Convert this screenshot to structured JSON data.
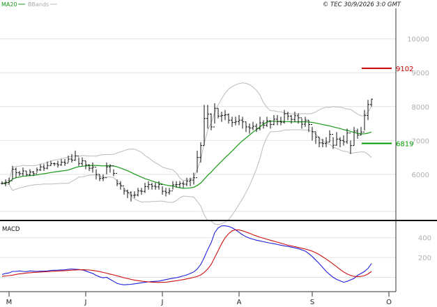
{
  "header": {
    "copyright": "© TEC 30/9/2026 3:0 GMT"
  },
  "legend": [
    {
      "label": "MA20",
      "color": "#1a9a1a"
    },
    {
      "label": "BBands",
      "color": "#bbbbbb"
    }
  ],
  "colors": {
    "price_bars": "#111111",
    "ma20": "#1a9a1a",
    "bbands": "#bbbbbb",
    "resistance": "#cc0000",
    "support": "#009900",
    "macd": "#1f1fdc",
    "signal": "#cc1010",
    "grid": "#e2e2e2"
  },
  "chart_data": [
    {
      "type": "ohlc",
      "panel": "price",
      "y_ticks": [
        6000,
        7000,
        8000,
        9000,
        10000
      ],
      "y_tick_labels": [
        "6000",
        "7000",
        "8000",
        "9000",
        "10000"
      ],
      "ylim": [
        4700,
        10900
      ],
      "x_ticks": [
        {
          "label": "M",
          "index": 2
        },
        {
          "label": "J",
          "index": 24
        },
        {
          "label": "J",
          "index": 46
        },
        {
          "label": "A",
          "index": 68
        },
        {
          "label": "S",
          "index": 89
        },
        {
          "label": "O",
          "index": 111
        }
      ],
      "levels": [
        {
          "name": "resistance",
          "label": "9102",
          "value": 9130,
          "color": "#cc0000"
        },
        {
          "name": "support",
          "label": "6819",
          "value": 6915,
          "color": "#009900"
        }
      ],
      "close": [
        5730,
        5760,
        5810,
        6150,
        6050,
        6020,
        6100,
        5990,
        6070,
        6020,
        6130,
        6220,
        6180,
        6260,
        6320,
        6310,
        6280,
        6360,
        6330,
        6450,
        6420,
        6540,
        6320,
        6400,
        6280,
        6180,
        6210,
        6000,
        5880,
        5900,
        6220,
        6250,
        6030,
        5720,
        5660,
        5510,
        5460,
        5380,
        5390,
        5510,
        5500,
        5640,
        5700,
        5650,
        5630,
        5700,
        5500,
        5460,
        5510,
        5690,
        5700,
        5730,
        5710,
        5800,
        5830,
        5900,
        6500,
        6850,
        7650,
        7780,
        7400,
        7950,
        7720,
        7740,
        7760,
        7600,
        7530,
        7560,
        7600,
        7550,
        7400,
        7370,
        7420,
        7350,
        7520,
        7450,
        7580,
        7470,
        7630,
        7560,
        7540,
        7790,
        7720,
        7620,
        7730,
        7670,
        7480,
        7600,
        7470,
        7260,
        7100,
        6930,
        6910,
        6950,
        7180,
        6860,
        7040,
        7000,
        6960,
        7220,
        6850,
        7280,
        7160,
        7250,
        7740,
        8060,
        8220
      ],
      "high": [
        5800,
        5850,
        5900,
        6250,
        6200,
        6100,
        6200,
        6100,
        6150,
        6100,
        6200,
        6300,
        6300,
        6380,
        6400,
        6350,
        6400,
        6450,
        6450,
        6550,
        6600,
        6700,
        6500,
        6500,
        6400,
        6300,
        6350,
        6150,
        6000,
        6000,
        6350,
        6300,
        6150,
        5850,
        5800,
        5600,
        5550,
        5500,
        5500,
        5600,
        5600,
        5750,
        5800,
        5750,
        5750,
        5800,
        5650,
        5600,
        5600,
        5800,
        5800,
        5800,
        5800,
        5900,
        5900,
        6050,
        6700,
        6950,
        8050,
        8050,
        7800,
        8100,
        7950,
        7850,
        7900,
        7800,
        7700,
        7700,
        7750,
        7700,
        7550,
        7500,
        7550,
        7500,
        7700,
        7600,
        7700,
        7600,
        7750,
        7750,
        7700,
        7900,
        7850,
        7750,
        7850,
        7800,
        7650,
        7700,
        7600,
        7400,
        7250,
        7100,
        7050,
        7100,
        7300,
        7100,
        7250,
        7100,
        7150,
        7350,
        7000,
        7400,
        7350,
        7400,
        7900,
        8200,
        8230
      ],
      "low": [
        5700,
        5650,
        5700,
        5850,
        5900,
        5950,
        5950,
        5950,
        5950,
        5950,
        6050,
        6100,
        6100,
        6150,
        6250,
        6250,
        6200,
        6250,
        6250,
        6350,
        6350,
        6400,
        6250,
        6250,
        6150,
        6100,
        6050,
        5850,
        5800,
        5800,
        6000,
        6050,
        5950,
        5650,
        5550,
        5400,
        5300,
        5200,
        5300,
        5350,
        5400,
        5450,
        5550,
        5550,
        5550,
        5550,
        5400,
        5350,
        5400,
        5550,
        5600,
        5600,
        5600,
        5650,
        5650,
        5700,
        6050,
        6350,
        6850,
        7350,
        7300,
        7500,
        7650,
        7550,
        7600,
        7500,
        7400,
        7450,
        7450,
        7350,
        7250,
        7200,
        7300,
        7250,
        7300,
        7350,
        7400,
        7350,
        7450,
        7450,
        7450,
        7500,
        7600,
        7500,
        7550,
        7500,
        7350,
        7400,
        7250,
        7000,
        6900,
        6800,
        6800,
        6800,
        6950,
        6750,
        6850,
        6800,
        6850,
        6900,
        6600,
        6850,
        7050,
        7150,
        7300,
        7600,
        8000
      ]
    },
    {
      "type": "line",
      "panel": "macd",
      "title": "MACD",
      "y_ticks": [
        200,
        400
      ],
      "y_tick_labels": [
        "200",
        "400"
      ],
      "ylim": [
        -130,
        560
      ],
      "series": [
        {
          "name": "MACD",
          "color": "#1f1fdc",
          "values": [
            30,
            40,
            45,
            60,
            60,
            65,
            60,
            58,
            65,
            62,
            60,
            63,
            62,
            65,
            70,
            72,
            73,
            75,
            76,
            82,
            85,
            82,
            80,
            75,
            65,
            52,
            40,
            20,
            5,
            -5,
            0,
            -20,
            -40,
            -60,
            -70,
            -75,
            -72,
            -70,
            -65,
            -60,
            -55,
            -50,
            -45,
            -43,
            -40,
            -38,
            -30,
            -22,
            -15,
            -8,
            -3,
            5,
            15,
            25,
            40,
            55,
            85,
            130,
            200,
            280,
            350,
            450,
            500,
            520,
            520,
            515,
            500,
            480,
            455,
            430,
            410,
            395,
            385,
            375,
            368,
            360,
            352,
            345,
            340,
            332,
            325,
            318,
            312,
            305,
            298,
            290,
            278,
            265,
            240,
            210,
            175,
            140,
            100,
            60,
            30,
            0,
            -20,
            -35,
            -50,
            -40,
            -25,
            -10,
            20,
            40,
            60,
            90,
            140
          ]
        },
        {
          "name": "Signal",
          "color": "#cc1010",
          "values": [
            10,
            14,
            18,
            23,
            30,
            36,
            40,
            44,
            47,
            50,
            52,
            54,
            56,
            58,
            60,
            62,
            64,
            66,
            68,
            70,
            73,
            75,
            76,
            77,
            76,
            74,
            70,
            65,
            58,
            50,
            42,
            33,
            25,
            16,
            6,
            -4,
            -12,
            -20,
            -27,
            -33,
            -38,
            -42,
            -45,
            -48,
            -50,
            -51,
            -50,
            -48,
            -44,
            -39,
            -34,
            -28,
            -22,
            -15,
            -8,
            0,
            10,
            25,
            50,
            85,
            130,
            200,
            270,
            340,
            400,
            440,
            470,
            480,
            478,
            470,
            458,
            445,
            430,
            418,
            405,
            395,
            385,
            375,
            365,
            355,
            345,
            335,
            325,
            318,
            310,
            302,
            294,
            286,
            276,
            264,
            248,
            230,
            208,
            185,
            160,
            135,
            108,
            80,
            55,
            35,
            20,
            10,
            8,
            10,
            18,
            35,
            60
          ]
        }
      ]
    }
  ]
}
